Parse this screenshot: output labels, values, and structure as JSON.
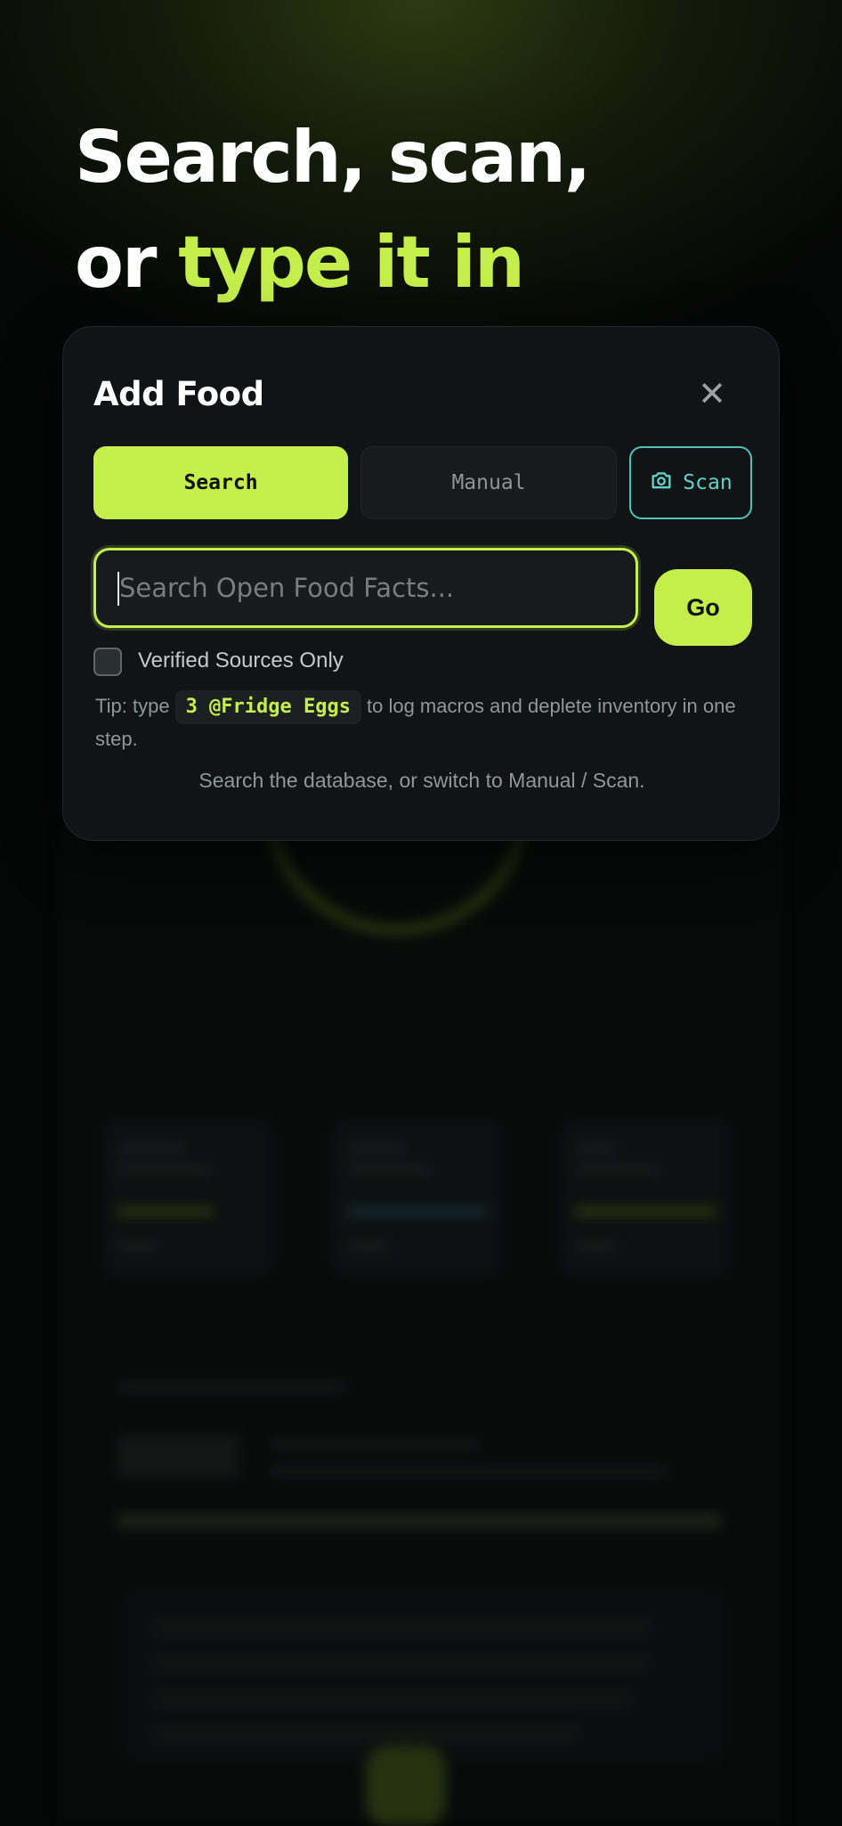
{
  "headline": {
    "line1": "Search, scan,",
    "line2_prefix": "or ",
    "line2_accent": "type it in"
  },
  "modal": {
    "title": "Add Food",
    "close_icon": "close-icon",
    "tabs": [
      {
        "label": "Search",
        "active": true
      },
      {
        "label": "Manual",
        "active": false
      },
      {
        "label": "Scan",
        "active": false,
        "icon": "camera-icon"
      }
    ],
    "search": {
      "placeholder": "Search Open Food Facts...",
      "value": ""
    },
    "go_label": "Go",
    "verified_only": {
      "label": "Verified Sources Only",
      "checked": false
    },
    "tip": {
      "prefix": "Tip: type",
      "code": "3 @Fridge Eggs",
      "suffix": "to log macros and deplete inventory in one step."
    },
    "hint": "Search the database, or switch to Manual / Scan."
  },
  "colors": {
    "accent": "#c4ee4c",
    "scan_accent": "#4fc2ba",
    "background": "#050606",
    "modal_bg": "#111314"
  }
}
